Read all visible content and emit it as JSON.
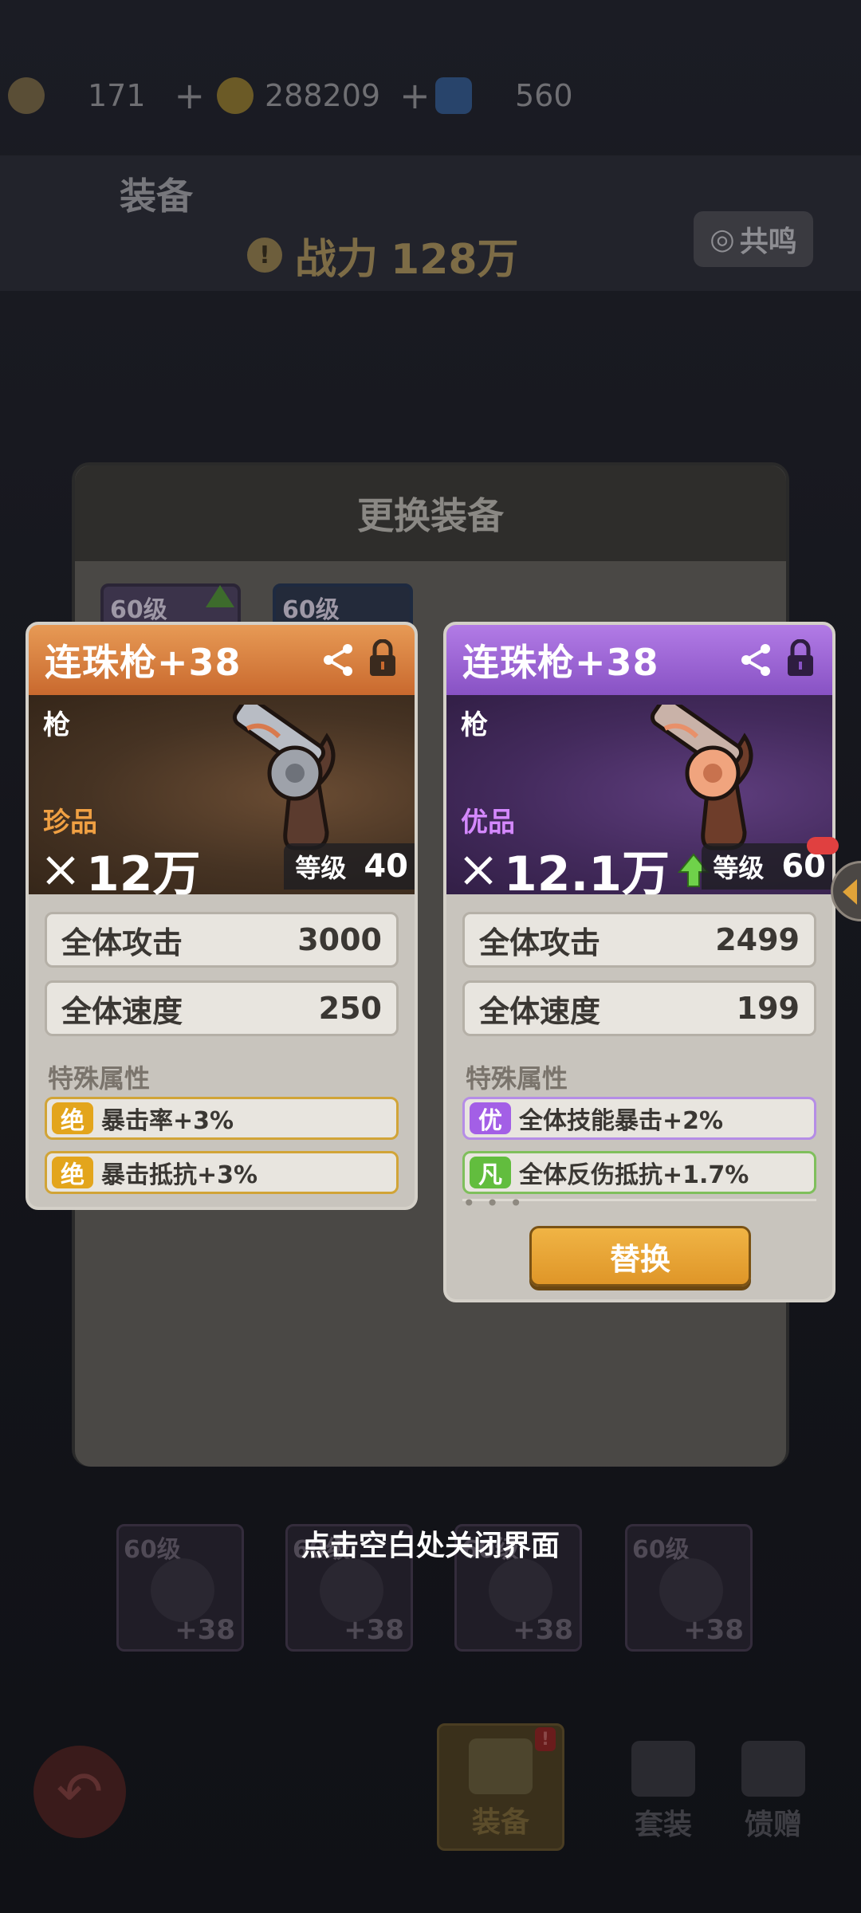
{
  "topbar": {
    "stamina": "171",
    "gold": "288209",
    "gems": "560",
    "colors": {
      "stamina": "#6b5d3e",
      "gold": "#7d6a2c",
      "gems": "#33527d"
    }
  },
  "header": {
    "title": "装备",
    "power_label": "战力",
    "power_value": "128万",
    "resonate_label": "共鸣"
  },
  "dialog": {
    "title": "更换装备",
    "mini_cards": [
      {
        "level": "60级"
      },
      {
        "level": "60级"
      }
    ]
  },
  "current_item": {
    "name": "连珠枪+38",
    "type": "枪",
    "rarity": "珍品",
    "power": "12万",
    "level_label": "等级",
    "level": "40",
    "stats": [
      {
        "label": "全体攻击",
        "value": "3000"
      },
      {
        "label": "全体速度",
        "value": "250"
      }
    ],
    "special_title": "特殊属性",
    "special": [
      {
        "tag": "绝",
        "text": "暴击率+3%"
      },
      {
        "tag": "绝",
        "text": "暴击抵抗+3%"
      }
    ],
    "colors": {
      "header": "#d97b3c",
      "rarity": "#f0a043"
    }
  },
  "new_item": {
    "name": "连珠枪+38",
    "type": "枪",
    "rarity": "优品",
    "power": "12.1万",
    "level_label": "等级",
    "level": "60",
    "stats": [
      {
        "label": "全体攻击",
        "value": "2499"
      },
      {
        "label": "全体速度",
        "value": "199"
      }
    ],
    "special_title": "特殊属性",
    "special": [
      {
        "tag": "优",
        "text": "全体技能暴击+2%"
      },
      {
        "tag": "凡",
        "text": "全体反伤抵抗+1.7%"
      }
    ],
    "replace_label": "替换",
    "colors": {
      "header": "#9d67d6",
      "rarity": "#d488ff"
    }
  },
  "close_hint": "点击空白处关闭界面",
  "bottom_slots": [
    {
      "level": "60级",
      "plus": "+38"
    },
    {
      "level": "60级",
      "plus": "+38"
    },
    {
      "level": "60级",
      "plus": "+38"
    },
    {
      "level": "60级",
      "plus": "+38"
    }
  ],
  "bottom_nav": {
    "equip": "装备",
    "set": "套装",
    "gift": "馈赠",
    "equip_badge": "!"
  }
}
